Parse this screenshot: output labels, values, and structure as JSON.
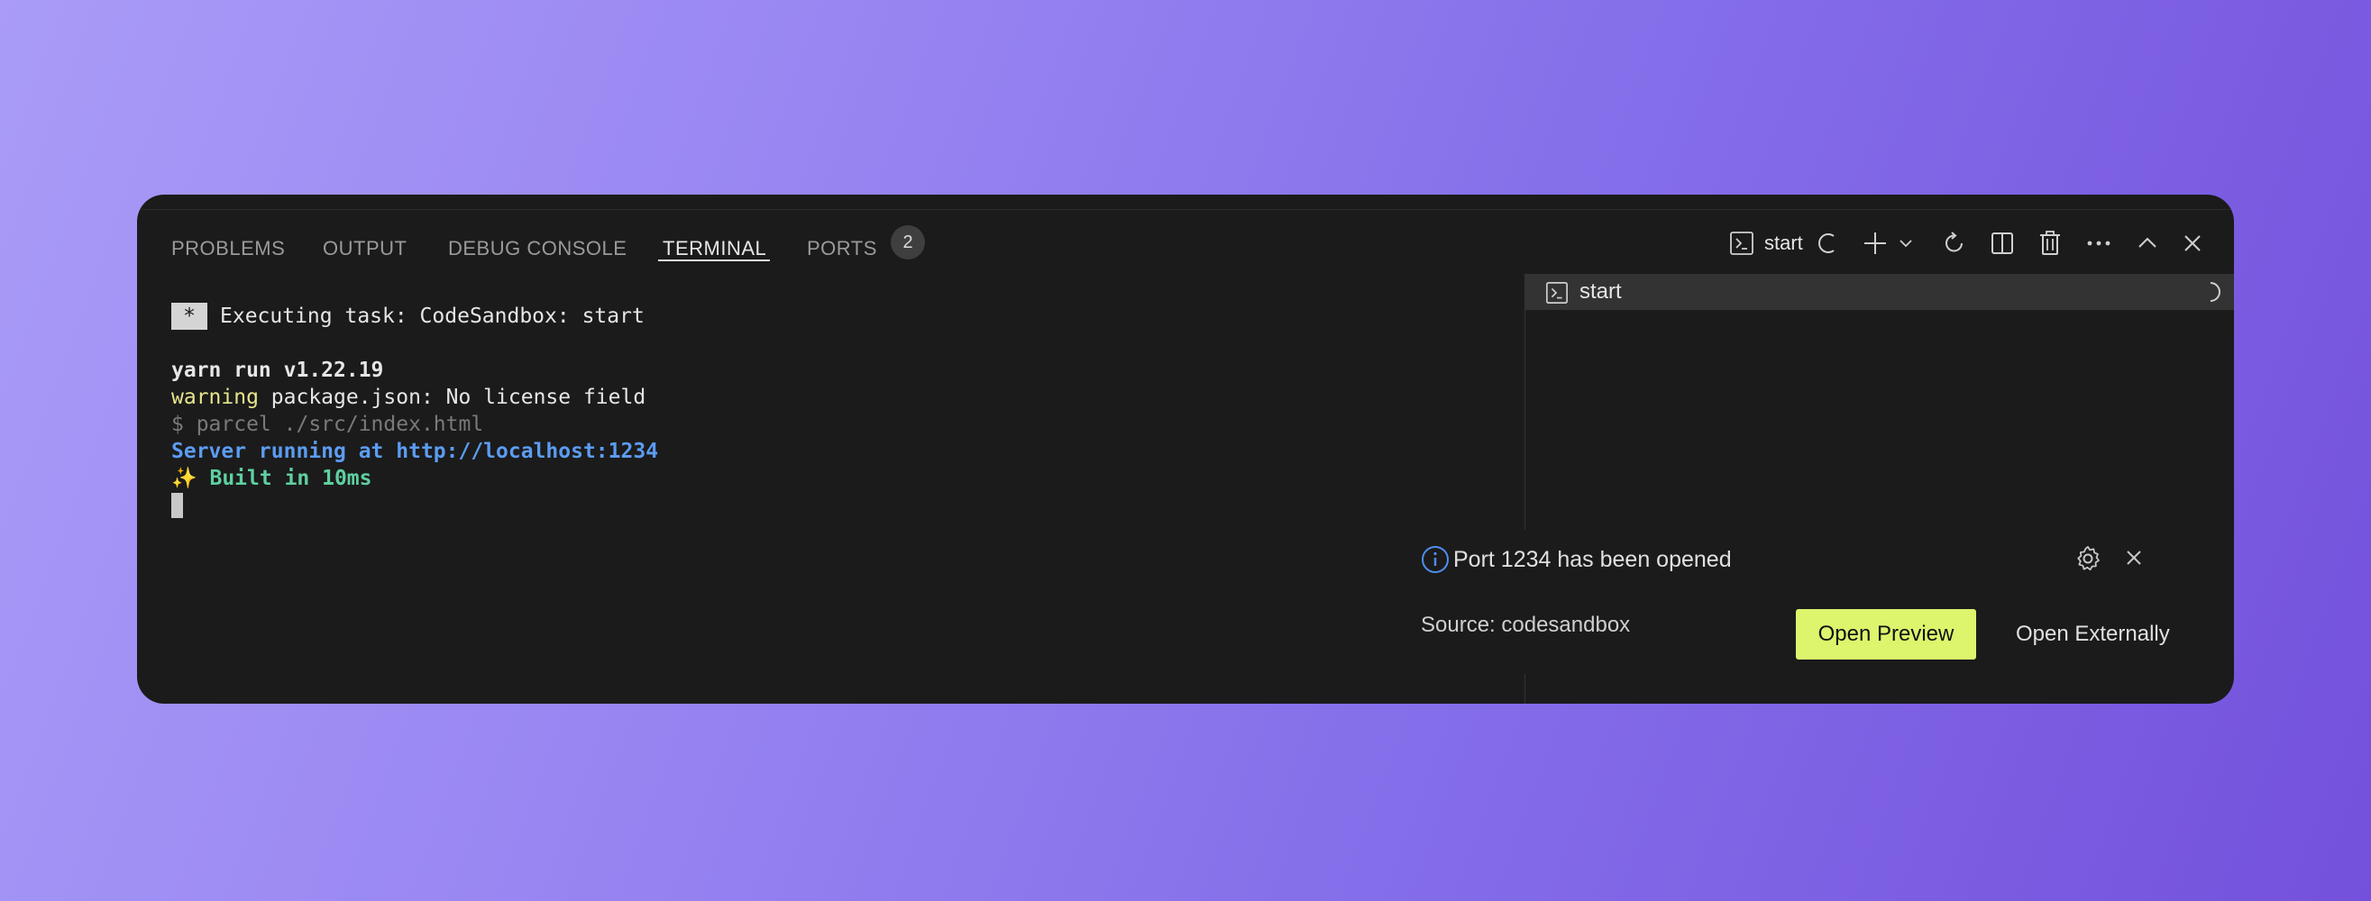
{
  "panel": {
    "tabs": [
      {
        "label": "PROBLEMS"
      },
      {
        "label": "OUTPUT"
      },
      {
        "label": "DEBUG CONSOLE"
      },
      {
        "label": "TERMINAL",
        "active": true
      },
      {
        "label": "PORTS",
        "badge": "2"
      }
    ],
    "toolbar": {
      "terminal_name": "start",
      "icons": [
        "terminal-icon",
        "loading-spinner-icon",
        "plus-icon",
        "chevron-down-icon",
        "refresh-icon",
        "split-editor-icon",
        "trash-icon",
        "more-icon",
        "chevron-up-icon",
        "close-icon"
      ]
    }
  },
  "terminal": {
    "task_marker": "*",
    "task_line": "Executing task: CodeSandbox: start",
    "yarn_line": "yarn run v1.22.19",
    "warning_word": "warning",
    "warning_rest": " package.json: No license field",
    "command_line": "$ parcel ./src/index.html",
    "server_line": "Server running at http://localhost:1234",
    "built_emoji": "✨",
    "built_line": " Built in 10ms"
  },
  "terminal_list": {
    "items": [
      {
        "label": "start",
        "status": "loading"
      }
    ]
  },
  "notification": {
    "message": "Port 1234 has been opened",
    "source": "Source: codesandbox",
    "primary_button": "Open Preview",
    "secondary_button": "Open Externally"
  },
  "colors": {
    "accent_button": "#dcf56d",
    "server_text": "#5b9cf2",
    "built_text": "#5fd0a0",
    "warning_text": "#e8e58d",
    "info_icon": "#4f8ff0"
  }
}
